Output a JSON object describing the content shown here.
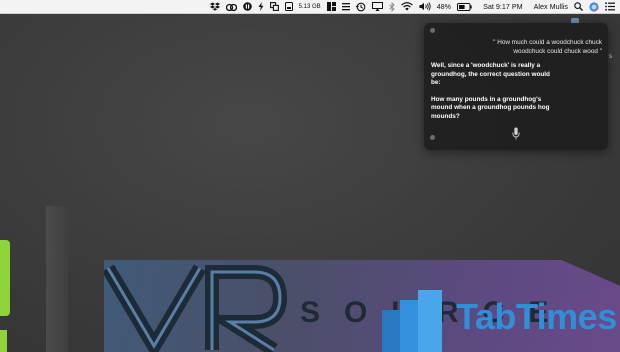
{
  "menubar": {
    "disk_space": "5.13 GB",
    "battery_percent": "48%",
    "clock": "Sat 9:17 PM",
    "user_name": "Alex Mullis",
    "icons": [
      "dropbox-icon",
      "creative-cloud-icon",
      "pause-icon",
      "bolt-icon",
      "copy-icon",
      "disk-icon",
      "grid-icon",
      "time-machine-icon",
      "airplay-icon",
      "bluetooth-icon",
      "wifi-icon",
      "volume-icon",
      "battery-icon",
      "spotlight-icon",
      "siri-icon",
      "notification-center-icon"
    ]
  },
  "siri": {
    "query": "\" How much could a woodchuck chuck woodchuck could chuck wood \"",
    "answer_lines": [
      "Well, since a 'woodchuck' is really a groundhog, the correct question would be:",
      "How many pounds in a groundhog's mound when a groundhog pounds hog mounds?"
    ]
  },
  "side_fragment": "s",
  "wallpaper": {
    "source_word": "SOURCE",
    "brand_name": "TabTimes"
  },
  "colors": {
    "menubar_bg": "#f3f3f3",
    "desktop_bg": "#3a3a3a",
    "siri_bg": "#1e1e20",
    "brand_blue": "#2f8fd8",
    "accent_green": "#8ed43a"
  }
}
